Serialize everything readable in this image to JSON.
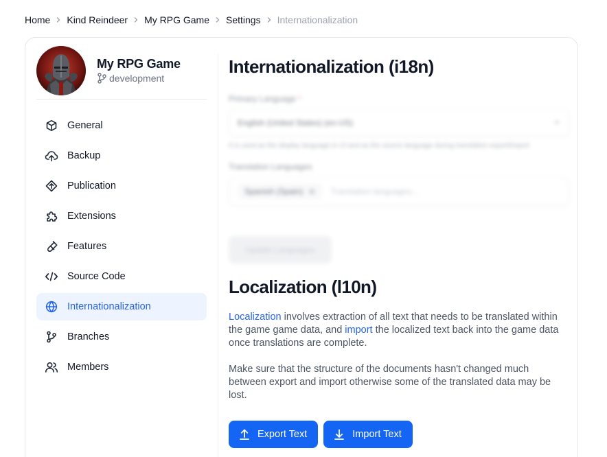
{
  "breadcrumb": [
    "Home",
    "Kind Reindeer",
    "My RPG Game",
    "Settings",
    "Internationalization"
  ],
  "project": {
    "name": "My RPG Game",
    "branch": "development"
  },
  "nav": [
    {
      "label": "General",
      "icon": "cube-icon"
    },
    {
      "label": "Backup",
      "icon": "cloud-upload-icon"
    },
    {
      "label": "Publication",
      "icon": "publish-icon"
    },
    {
      "label": "Extensions",
      "icon": "puzzle-icon"
    },
    {
      "label": "Features",
      "icon": "flask-icon"
    },
    {
      "label": "Source Code",
      "icon": "code-icon"
    },
    {
      "label": "Internationalization",
      "icon": "globe-icon",
      "active": true
    },
    {
      "label": "Branches",
      "icon": "branch-icon"
    },
    {
      "label": "Members",
      "icon": "users-icon"
    }
  ],
  "i18n": {
    "title": "Internationalization (i18n)",
    "primary_label": "Primary Language",
    "primary_value": "English (United States) (en-US)",
    "primary_hint": "It is used as the display language in UI and as the source language during translation export/import",
    "translation_label": "Translation Languages",
    "translation_tag": "Spanish (Spain)",
    "translation_placeholder": "Translation languages...",
    "update_button": "Update Languages"
  },
  "l10n": {
    "title": "Localization (l10n)",
    "p1_link1": "Localization",
    "p1_text1": " involves extraction of all text that needs to be translated within the game game data, and ",
    "p1_link2": "import",
    "p1_text2": " the localized text back into the game data once translations are complete.",
    "p2": "Make sure that the structure of the documents hasn't changed much between export and import otherwise some of the translated data may be lost.",
    "export_button": "Export Text",
    "import_button": "Import Text"
  },
  "colors": {
    "accent": "#1565f5",
    "active_bg": "#eef4ff",
    "active_text": "#2563eb"
  }
}
